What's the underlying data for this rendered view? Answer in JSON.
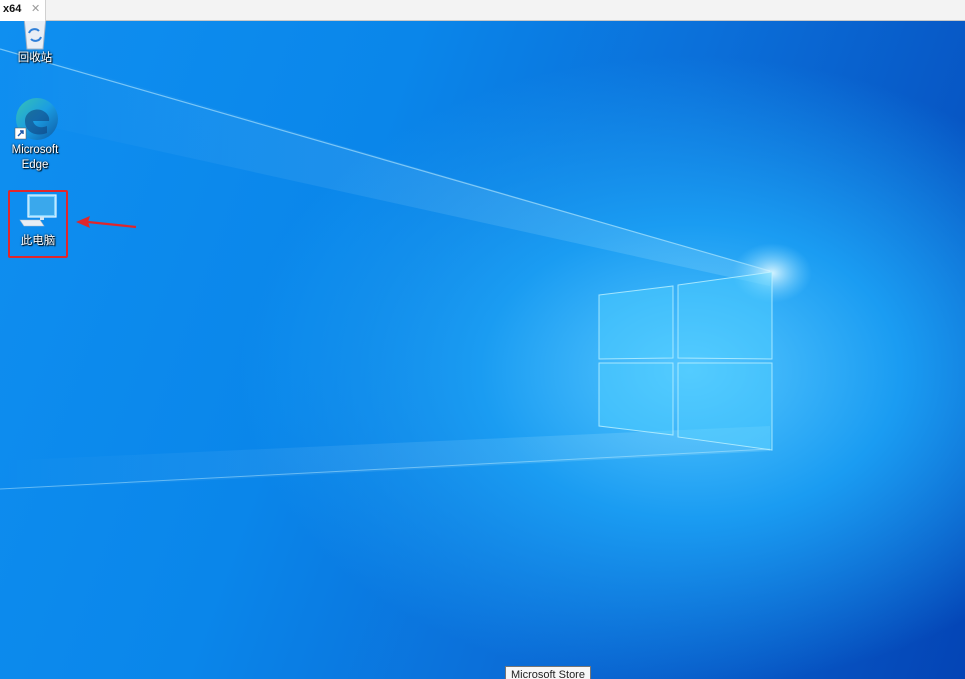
{
  "tab": {
    "label": "x64",
    "close_glyph": "✕"
  },
  "desktop": {
    "icons": [
      {
        "label": "回收站",
        "icon": "recycle-bin-icon"
      },
      {
        "label": "Microsoft\nEdge",
        "line1": "Microsoft",
        "line2": "Edge",
        "icon": "edge-icon"
      },
      {
        "label": "此电脑",
        "icon": "this-pc-icon"
      }
    ],
    "tooltip": "Microsoft Store",
    "annotation": {
      "color": "#e0262b",
      "icon": "red-arrow-icon"
    }
  },
  "colors": {
    "wallpaper": "#0b78e3",
    "highlight": "#e0262b"
  }
}
